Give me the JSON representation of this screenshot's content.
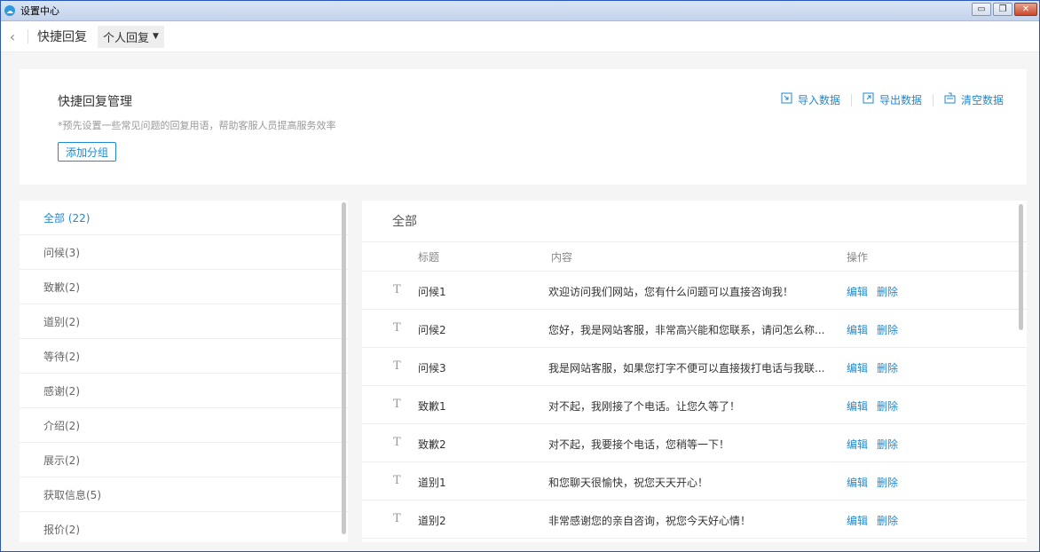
{
  "window": {
    "title": "设置中心",
    "controls": {
      "minimize": "▭",
      "restore": "❐",
      "close": "✕"
    }
  },
  "nav": {
    "back_icon": "back-chevron-icon",
    "title": "快捷回复",
    "dropdown_value": "个人回复"
  },
  "header": {
    "title": "快捷回复管理",
    "description": "*预先设置一些常见问题的回复用语，帮助客服人员提高服务效率",
    "add_group_label": "添加分组",
    "actions": [
      {
        "label": "导入数据",
        "icon": "import-icon"
      },
      {
        "label": "导出数据",
        "icon": "export-icon"
      },
      {
        "label": "清空数据",
        "icon": "clear-icon"
      }
    ]
  },
  "groups": [
    {
      "label": "全部 (22)",
      "active": true
    },
    {
      "label": "问候(3)"
    },
    {
      "label": "致歉(2)"
    },
    {
      "label": "道别(2)"
    },
    {
      "label": "等待(2)"
    },
    {
      "label": "感谢(2)"
    },
    {
      "label": "介绍(2)"
    },
    {
      "label": "展示(2)"
    },
    {
      "label": "获取信息(5)"
    },
    {
      "label": "报价(2)"
    }
  ],
  "list": {
    "title": "全部",
    "columns": {
      "title": "标题",
      "content": "内容",
      "ops": "操作"
    },
    "type_icon_glyph": "T",
    "edit_label": "编辑",
    "delete_label": "删除",
    "rows": [
      {
        "title": "问候1",
        "content": "欢迎访问我们网站，您有什么问题可以直接咨询我！"
      },
      {
        "title": "问候2",
        "content": "您好，我是网站客服，非常高兴能和您联系，请问怎么称..."
      },
      {
        "title": "问候3",
        "content": "我是网站客服，如果您打字不便可以直接拨打电话与我联..."
      },
      {
        "title": "致歉1",
        "content": "对不起，我刚接了个电话。让您久等了！"
      },
      {
        "title": "致歉2",
        "content": "对不起，我要接个电话，您稍等一下！"
      },
      {
        "title": "道别1",
        "content": "和您聊天很愉快，祝您天天开心！"
      },
      {
        "title": "道别2",
        "content": "非常感谢您的亲自咨询，祝您今天好心情！"
      }
    ]
  },
  "colors": {
    "accent": "#1e8ad6",
    "window_border": "#2b57b8"
  }
}
